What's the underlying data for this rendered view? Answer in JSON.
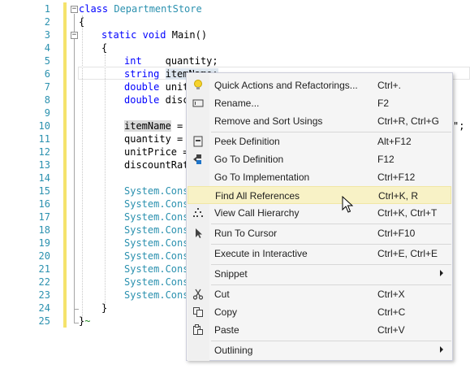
{
  "line_numbers": [
    "1",
    "2",
    "3",
    "4",
    "5",
    "6",
    "7",
    "8",
    "9",
    "10",
    "11",
    "12",
    "13",
    "14",
    "15",
    "16",
    "17",
    "18",
    "19",
    "20",
    "21",
    "22",
    "23",
    "24",
    "25"
  ],
  "code": {
    "l1_kw": "class",
    "l1_name": "DepartmentStore",
    "l2": "{",
    "l3_static": "static",
    "l3_void": "void",
    "l3_main": "Main()",
    "l4": "{",
    "l5_type": "int",
    "l5_var": "quantity;",
    "l6_type": "string",
    "l6_var": "itemName;",
    "l7_type": "double",
    "l7_var": "unit",
    "l8_type": "double",
    "l8_var": "disc",
    "l10_name": "itemName",
    "l10_rest": " =",
    "l10_tail": "\";",
    "l11": "quantity =",
    "l12": "unitPrice =",
    "l13": "discountRat",
    "console": "System.Cons",
    "l24": "}",
    "l25": "}"
  },
  "context_menu": {
    "items": [
      {
        "label": "Quick Actions and Refactorings...",
        "shortcut": "Ctrl+.",
        "icon": "lightbulb-icon"
      },
      {
        "label": "Rename...",
        "shortcut": "F2",
        "icon": "rename-icon"
      },
      {
        "label": "Remove and Sort Usings",
        "shortcut": "Ctrl+R, Ctrl+G",
        "icon": ""
      },
      {
        "label": "Peek Definition",
        "shortcut": "Alt+F12",
        "icon": "peek-definition-icon"
      },
      {
        "label": "Go To Definition",
        "shortcut": "F12",
        "icon": "go-to-definition-icon"
      },
      {
        "label": "Go To Implementation",
        "shortcut": "Ctrl+F12",
        "icon": ""
      },
      {
        "label": "Find All References",
        "shortcut": "Ctrl+K, R",
        "icon": ""
      },
      {
        "label": "View Call Hierarchy",
        "shortcut": "Ctrl+K, Ctrl+T",
        "icon": "call-hierarchy-icon"
      },
      {
        "label": "Run To Cursor",
        "shortcut": "Ctrl+F10",
        "icon": "run-to-cursor-icon"
      },
      {
        "label": "Execute in Interactive",
        "shortcut": "Ctrl+E, Ctrl+E",
        "icon": ""
      },
      {
        "label": "Snippet",
        "shortcut": "",
        "icon": ""
      },
      {
        "label": "Cut",
        "shortcut": "Ctrl+X",
        "icon": "cut-icon"
      },
      {
        "label": "Copy",
        "shortcut": "Ctrl+C",
        "icon": "copy-icon"
      },
      {
        "label": "Paste",
        "shortcut": "Ctrl+V",
        "icon": "paste-icon"
      },
      {
        "label": "Outlining",
        "shortcut": "",
        "icon": ""
      }
    ],
    "hovered_item": "Find All References"
  },
  "colors": {
    "keyword": "#0000ff",
    "type_name": "#2b91af",
    "line_number": "#2b91af",
    "change_bar": "#f5e36c",
    "menu_hover": "#f8f2c6"
  }
}
